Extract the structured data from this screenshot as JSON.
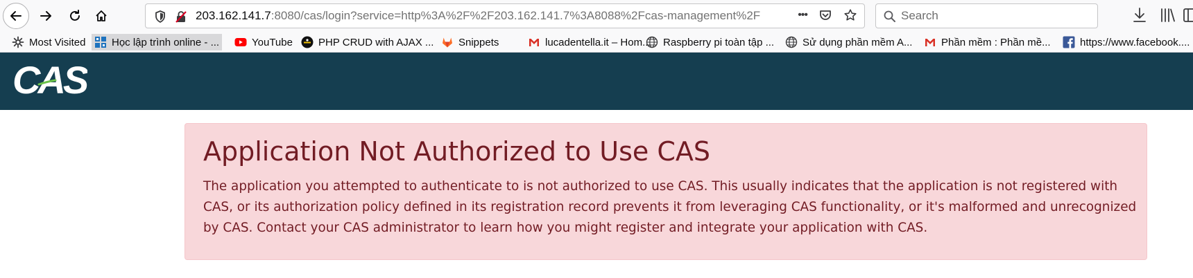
{
  "browser": {
    "url": {
      "host": "203.162.141.7",
      "rest": ":8080/cas/login?service=http%3A%2F%2F203.162.141.7%3A8088%2Fcas-management%2F"
    },
    "search": {
      "placeholder": "Search"
    },
    "overflow_label": "•••"
  },
  "bookmarks": [
    {
      "label": "Most Visited",
      "icon": "gear-icon"
    },
    {
      "label": "Học lập trình online - ...",
      "icon": "grid-icon"
    },
    {
      "label": "YouTube",
      "icon": "youtube-icon"
    },
    {
      "label": "PHP CRUD with AJAX ...",
      "icon": "php-icon"
    },
    {
      "label": "Snippets",
      "icon": "gitlab-icon"
    },
    {
      "label": "lucadentella.it – Hom...",
      "icon": "gmail-icon"
    },
    {
      "label": "Raspberry pi toàn tập ...",
      "icon": "globe-icon"
    },
    {
      "label": "Sử dụng phần mềm A...",
      "icon": "globe-icon"
    },
    {
      "label": "Phần mềm : Phần mề...",
      "icon": "gmail-icon"
    },
    {
      "label": "https://www.facebook....",
      "icon": "facebook-icon"
    }
  ],
  "header": {
    "logo_text": "CAS",
    "background": "#153e50"
  },
  "alert": {
    "title": "Application Not Authorized to Use CAS",
    "message": "The application you attempted to authenticate to is not authorized to use CAS. This usually indicates that the application is not registered with CAS, or its authorization policy defined in its registration record prevents it from leveraging CAS functionality, or it's malformed and unrecognized by CAS. Contact your CAS administrator to learn how you might register and integrate your application with CAS."
  }
}
